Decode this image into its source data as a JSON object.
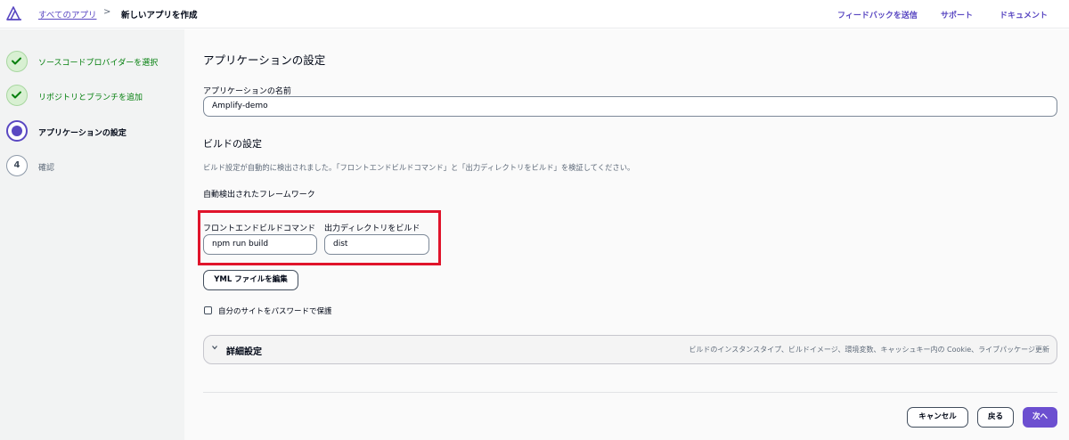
{
  "breadcrumb": {
    "all_apps": "すべてのアプリ",
    "separator": ">",
    "current": "新しいアプリを作成"
  },
  "header_links": {
    "feedback": "フィードバックを送信",
    "support": "サポート",
    "docs": "ドキュメント"
  },
  "steps": [
    {
      "label": "ソースコードプロバイダーを選択",
      "state": "done"
    },
    {
      "label": "リポジトリとブランチを追加",
      "state": "done"
    },
    {
      "label": "アプリケーションの設定",
      "state": "current"
    },
    {
      "number": "4",
      "label": "確認",
      "state": "future"
    }
  ],
  "main": {
    "title": "アプリケーションの設定",
    "app_name_label": "アプリケーションの名前",
    "app_name_value": "Amplify-demo",
    "build_title": "ビルドの設定",
    "build_desc": "ビルド設定が自動的に検出されました。「フロントエンドビルドコマンド」と「出力ディレクトリをビルド」を検証してください。",
    "framework_label": "自動検出されたフレームワーク",
    "frontend_cmd_label": "フロントエンドビルドコマンド",
    "frontend_cmd_value": "npm run build",
    "output_dir_label": "出力ディレクトリをビルド",
    "output_dir_value": "dist",
    "edit_yml_button": "YML ファイルを編集",
    "password_protect_label": "自分のサイトをパスワードで保護",
    "password_protect_checked": false,
    "advanced_title": "詳細設定",
    "advanced_desc": "ビルドのインスタンスタイプ、ビルドイメージ、環境変数、キャッシュキー内の Cookie、ライブパッケージ更新"
  },
  "footer": {
    "cancel": "キャンセル",
    "back": "戻る",
    "next": "次へ"
  },
  "colors": {
    "accent": "#5a48c2",
    "primary_button": "#6c4fd0",
    "done_green": "#037f0c",
    "highlight_red": "#e0142b"
  }
}
